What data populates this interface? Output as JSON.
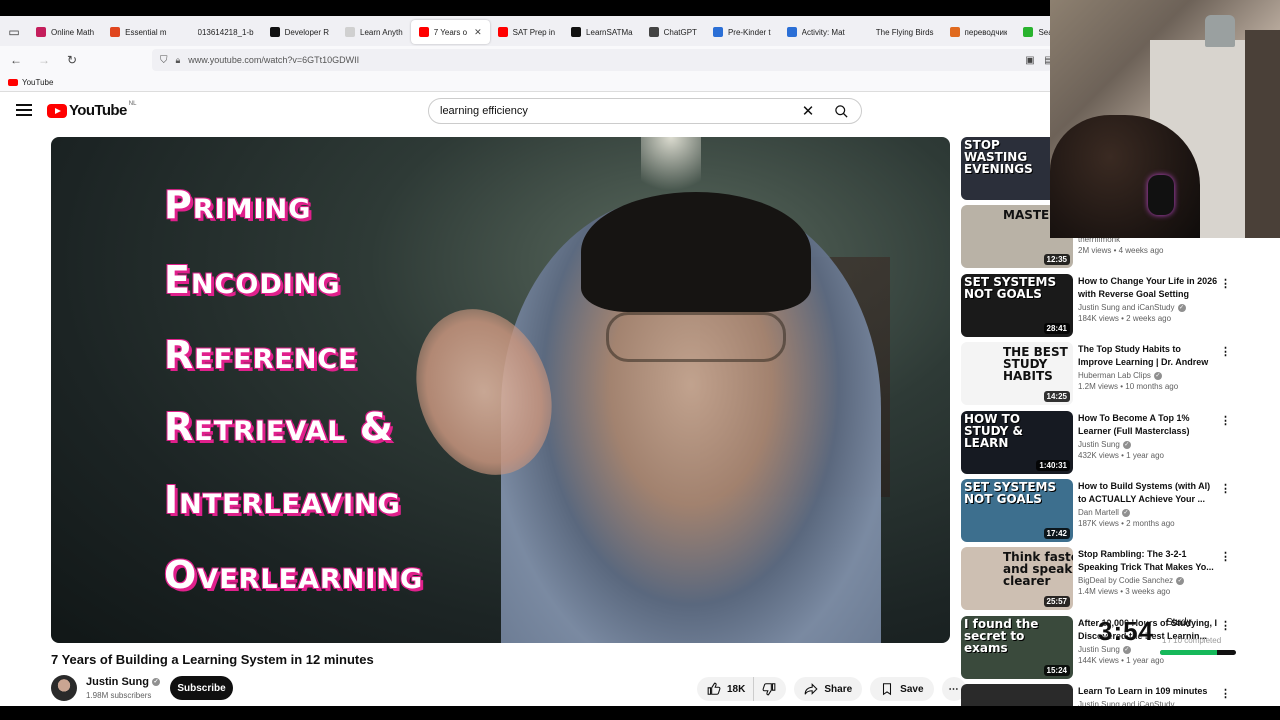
{
  "browser": {
    "tabs": [
      {
        "label": "Online Math",
        "color": "#c41e5c",
        "active": false
      },
      {
        "label": "Essential m",
        "color": "#e0461f",
        "active": false
      },
      {
        "label": "013614218_1-b",
        "color": "",
        "active": false
      },
      {
        "label": "Developer R",
        "color": "#111111",
        "active": false
      },
      {
        "label": "Learn Anyth",
        "color": "#d0d0d0",
        "active": false
      },
      {
        "label": "7 Years o",
        "color": "#ff0000",
        "active": true
      },
      {
        "label": "SAT Prep in",
        "color": "#ff0000",
        "active": false
      },
      {
        "label": "LearnSATMa",
        "color": "#111111",
        "active": false
      },
      {
        "label": "ChatGPT",
        "color": "#444444",
        "active": false
      },
      {
        "label": "Pre-Kinder t",
        "color": "#2b6fd6",
        "active": false
      },
      {
        "label": "Activity: Mat",
        "color": "#2b6fd6",
        "active": false
      },
      {
        "label": "The Flying Birds",
        "color": "",
        "active": false
      },
      {
        "label": "переводчик",
        "color": "#e06a1f",
        "active": false
      },
      {
        "label": "Search | arX",
        "color": "#29b32e",
        "active": false
      }
    ],
    "url": "www.youtube.com/watch?v=6GTt10GDWII",
    "bookmark": "YouTube"
  },
  "header": {
    "logo": "YouTube",
    "country_code": "NL",
    "search_query": "learning efficiency"
  },
  "video": {
    "overlay_lines": [
      "Priming",
      "Encoding",
      "Reference",
      "Retrieval &",
      "Interleaving",
      "Overlearning"
    ],
    "title": "7 Years of Building a Learning System in 12 minutes",
    "channel": "Justin Sung",
    "subscribers": "1.98M subscribers",
    "subscribe_label": "Subscribe",
    "likes": "18K",
    "share_label": "Share",
    "save_label": "Save"
  },
  "sidebar": {
    "items": [
      {
        "thumb_text": "STOP\nWASTING\nEVENINGS",
        "thumb_bg": "#2b2f3a",
        "duration": "",
        "title": "",
        "channel": "",
        "verified": false,
        "stats": ""
      },
      {
        "thumb_text": "MASTER ANYTHING",
        "thumb_bg": "#b9b2a6",
        "duration": "12:35",
        "title": "",
        "channel": "therriffmonk",
        "verified": false,
        "stats": "2M views • 4 weeks ago"
      },
      {
        "thumb_text": "SET SYSTEMS\nNOT GOALS",
        "thumb_bg": "#1a1a1a",
        "duration": "28:41",
        "title": "How to Change Your Life in 2026 with Reverse Goal Setting",
        "channel": "Justin Sung and iCanStudy",
        "verified": true,
        "stats": "184K views • 2 weeks ago"
      },
      {
        "thumb_text": "THE BEST\nSTUDY\nHABITS",
        "thumb_bg": "#f4f4f4",
        "duration": "14:25",
        "title": "The Top Study Habits to Improve Learning | Dr. Andrew ...",
        "channel": "Huberman Lab Clips",
        "verified": true,
        "stats": "1.2M views • 10 months ago"
      },
      {
        "thumb_text": "HOW TO\nSTUDY &\nLEARN",
        "thumb_bg": "#161a22",
        "duration": "1:40:31",
        "title": "How To Become A Top 1% Learner (Full Masterclass)",
        "channel": "Justin Sung",
        "verified": true,
        "stats": "432K views • 1 year ago"
      },
      {
        "thumb_text": "SET SYSTEMS\nNOT GOALS",
        "thumb_bg": "#3d6f8e",
        "duration": "17:42",
        "title": "How to Build Systems (with AI) to ACTUALLY Achieve Your ...",
        "channel": "Dan Martell",
        "verified": true,
        "stats": "187K views • 2 months ago"
      },
      {
        "thumb_text": "Think faster\nand speak\nclearer",
        "thumb_bg": "#cdbfb2",
        "duration": "25:57",
        "title": "Stop Rambling: The 3-2-1 Speaking Trick That Makes Yo...",
        "channel": "BigDeal by Codie Sanchez",
        "verified": true,
        "stats": "1.4M views • 3 weeks ago"
      },
      {
        "thumb_text": "I found the\nsecret to\nexams",
        "thumb_bg": "#3a4a3c",
        "duration": "15:24",
        "title": "After 10,000 Hours of Studying, I Discovered the Best Learnin...",
        "channel": "Justin Sung",
        "verified": true,
        "stats": "144K views • 1 year ago"
      },
      {
        "thumb_text": "",
        "thumb_bg": "#2a2a2a",
        "duration": "",
        "title": "Learn To Learn in 109 minutes",
        "channel": "Justin Sung and iCanStudy",
        "verified": false,
        "stats": ""
      }
    ]
  },
  "timer": {
    "time": "3:54",
    "task": "Study",
    "completed": "1 / 10 completed",
    "progress": 0.75,
    "progress_color": "#16b85a"
  }
}
